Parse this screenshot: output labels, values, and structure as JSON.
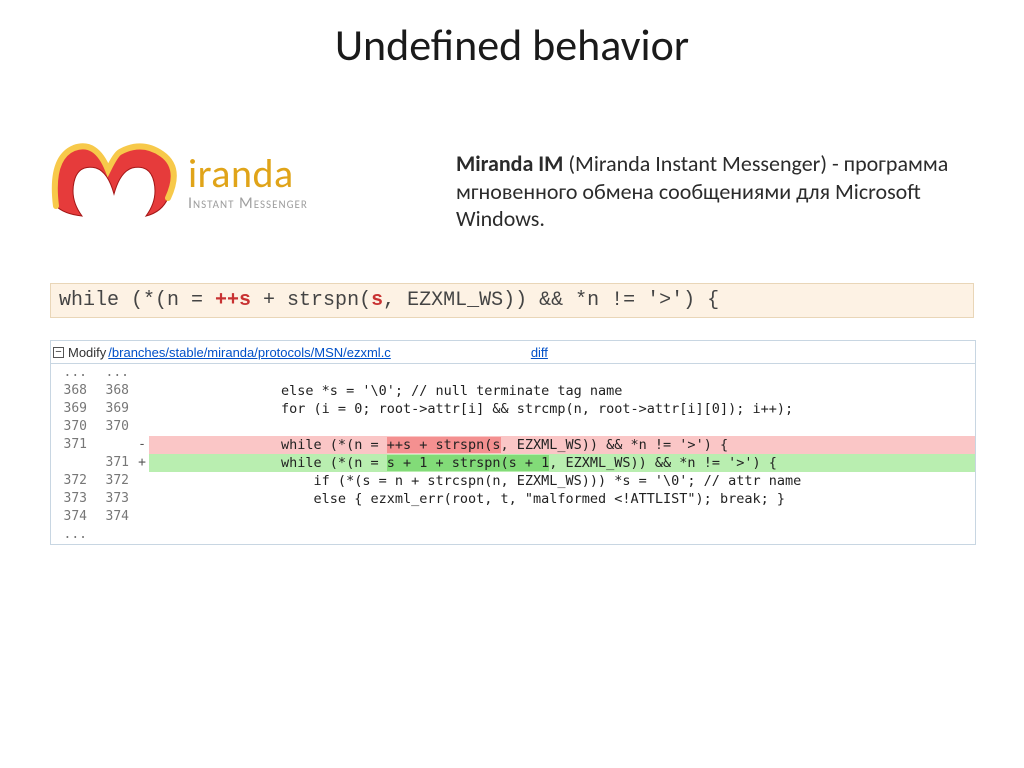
{
  "slide": {
    "title": "Undefined behavior"
  },
  "logo": {
    "brand": "iranda",
    "subtitle": "Instant Messenger"
  },
  "description": {
    "bold_name": "Miranda IM",
    "rest": " (Miranda Instant Messenger) - программа мгновенного обмена сообщениями для Microsoft Windows."
  },
  "code_highlight": {
    "p1": "while (*(n = ",
    "kw1": "++s",
    "p2": " + strspn(",
    "kw2": "s",
    "p3": ", EZXML_WS)) && *n != '>') {"
  },
  "diff": {
    "toggle_glyph": "−",
    "modify_label": "Modify",
    "path": "/branches/stable/miranda/protocols/MSN/ezxml.c",
    "diff_link": "diff",
    "rows": [
      {
        "l1": "...",
        "l2": "...",
        "sign": "",
        "code": "",
        "cls": ""
      },
      {
        "l1": "368",
        "l2": "368",
        "sign": "",
        "code": "                else *s = '\\0'; // null terminate tag name",
        "cls": ""
      },
      {
        "l1": "369",
        "l2": "369",
        "sign": "",
        "code": "                for (i = 0; root->attr[i] && strcmp(n, root->attr[i][0]); i++);",
        "cls": ""
      },
      {
        "l1": "370",
        "l2": "370",
        "sign": "",
        "code": "",
        "cls": ""
      },
      {
        "l1": "371",
        "l2": "",
        "sign": "-",
        "code": "                while (*(n = ",
        "hl": "++s + strspn(s",
        "tail": ", EZXML_WS)) && *n != '>') {",
        "cls": "row-del"
      },
      {
        "l1": "",
        "l2": "371",
        "sign": "+",
        "code": "                while (*(n = ",
        "hl": "s + 1 + strspn(s + 1",
        "tail": ", EZXML_WS)) && *n != '>') {",
        "cls": "row-add"
      },
      {
        "l1": "372",
        "l2": "372",
        "sign": "",
        "code": "                    if (*(s = n + strcspn(n, EZXML_WS))) *s = '\\0'; // attr name",
        "cls": ""
      },
      {
        "l1": "373",
        "l2": "373",
        "sign": "",
        "code": "                    else { ezxml_err(root, t, \"malformed <!ATTLIST\"); break; }",
        "cls": ""
      },
      {
        "l1": "374",
        "l2": "374",
        "sign": "",
        "code": "",
        "cls": ""
      },
      {
        "l1": "...",
        "l2": "",
        "sign": "",
        "code": "",
        "cls": ""
      }
    ]
  }
}
